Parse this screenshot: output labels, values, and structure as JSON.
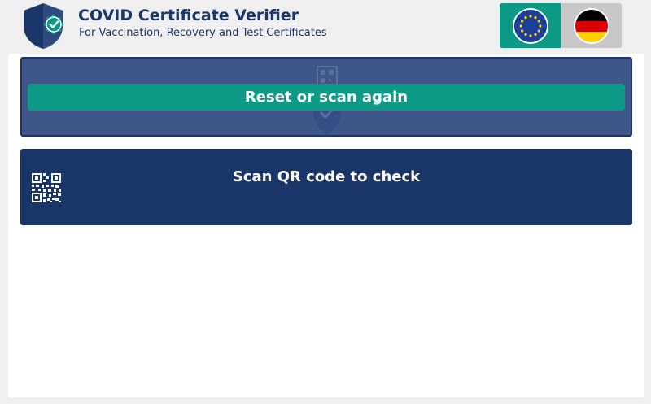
{
  "header": {
    "title": "COVID Certificate Verifier",
    "subtitle": "For Vaccination, Recovery and Test Certificates",
    "logo_icon": "shield-check-icon"
  },
  "language_switch": {
    "options": [
      {
        "code": "EU",
        "icon": "eu-flag-icon",
        "selected": true
      },
      {
        "code": "DE",
        "icon": "german-flag-icon",
        "selected": false
      }
    ]
  },
  "result": {
    "reset_label": "Reset or scan again"
  },
  "scan": {
    "label": "Scan QR code to check",
    "icon": "qr-code-icon"
  },
  "colors": {
    "primary": "#1a3668",
    "accent": "#0c9a86",
    "result_bg": "#3e5788",
    "inactive": "#c8c8c8"
  }
}
